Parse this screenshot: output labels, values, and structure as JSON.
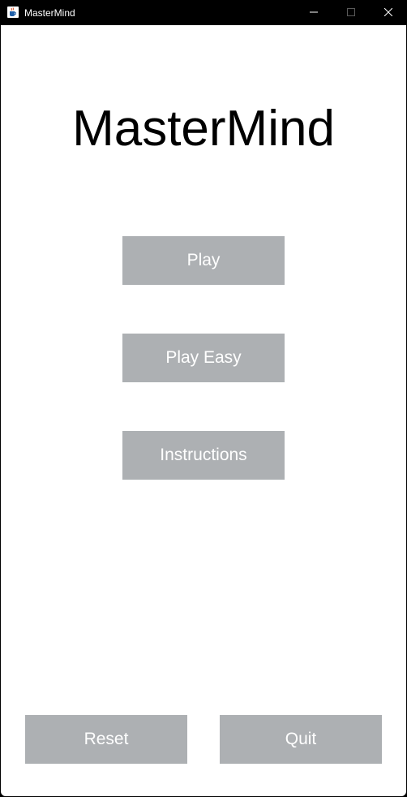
{
  "window": {
    "title": "MasterMind",
    "app_icon": "java-cup-icon",
    "controls": {
      "minimize_icon": "minimize-icon",
      "maximize_icon": "maximize-icon",
      "close_icon": "close-icon"
    }
  },
  "main": {
    "title": "MasterMind",
    "buttons": {
      "play": "Play",
      "play_easy": "Play Easy",
      "instructions": "Instructions",
      "reset": "Reset",
      "quit": "Quit"
    }
  },
  "colors": {
    "titlebar_bg": "#000000",
    "content_bg": "#ffffff",
    "button_bg": "#adb0b3",
    "button_text": "#ffffff",
    "title_text": "#000000"
  }
}
